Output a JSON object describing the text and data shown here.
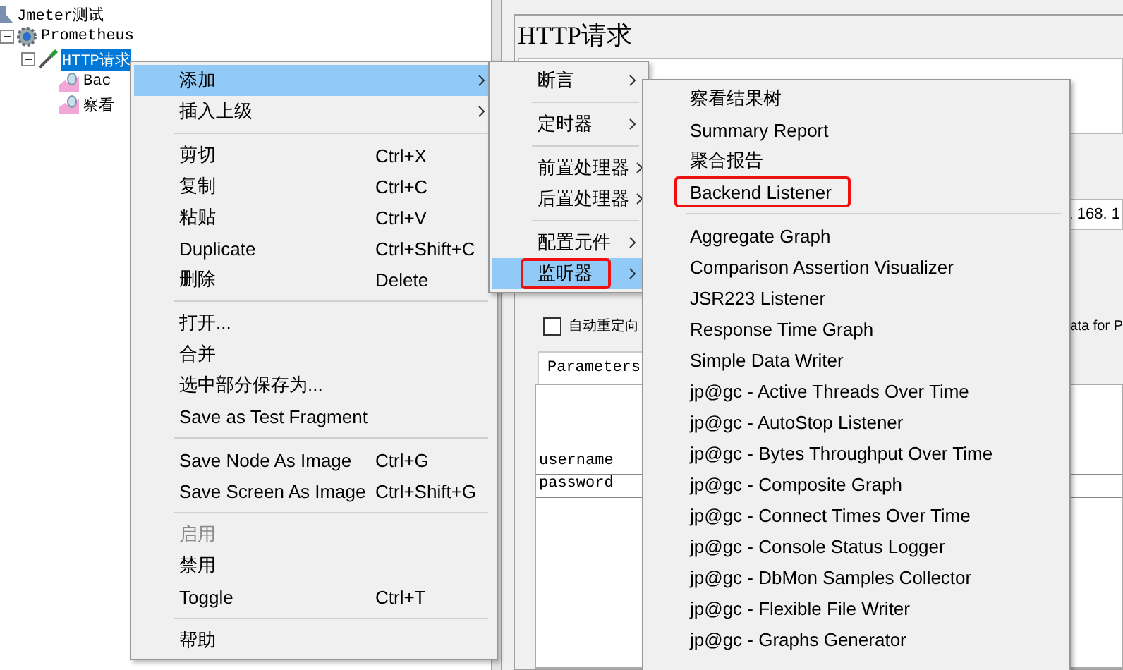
{
  "tree": [
    {
      "label": "Jmeter测试",
      "selected": false,
      "children": [
        {
          "label": "Prometheus",
          "selected": false,
          "expanded": true,
          "children": [
            {
              "label": "HTTP请求",
              "selected": true,
              "expanded": true,
              "children": [
                {
                  "label": "Bac",
                  "selected": false
                },
                {
                  "label": "察看",
                  "selected": false
                }
              ]
            }
          ]
        }
      ]
    }
  ],
  "editor": {
    "title": "HTTP请求",
    "server_fragment": ". 168. 1",
    "redirect_checkbox": {
      "label": "自动重定向",
      "checked": false
    },
    "option_fragment": "ata for P",
    "tabs": [
      {
        "label": "Parameters",
        "selected": true
      }
    ],
    "parameters": [
      {
        "name": "username"
      },
      {
        "name": "password"
      }
    ]
  },
  "context_menu": {
    "items": [
      {
        "kind": "item",
        "label": "添加",
        "submenu": true,
        "selected": true,
        "disabled": false,
        "annotated": false
      },
      {
        "kind": "item",
        "label": "插入上级",
        "submenu": true,
        "selected": false,
        "disabled": false,
        "annotated": false
      },
      {
        "kind": "separator"
      },
      {
        "kind": "item",
        "label": "剪切",
        "shortcut": "Ctrl+X",
        "submenu": false,
        "selected": false,
        "disabled": false,
        "annotated": false
      },
      {
        "kind": "item",
        "label": "复制",
        "shortcut": "Ctrl+C",
        "submenu": false,
        "selected": false,
        "disabled": false,
        "annotated": false
      },
      {
        "kind": "item",
        "label": "粘贴",
        "shortcut": "Ctrl+V",
        "submenu": false,
        "selected": false,
        "disabled": false,
        "annotated": false
      },
      {
        "kind": "item",
        "label": "Duplicate",
        "shortcut": "Ctrl+Shift+C",
        "submenu": false,
        "selected": false,
        "disabled": false,
        "annotated": false
      },
      {
        "kind": "item",
        "label": "删除",
        "shortcut": "Delete",
        "submenu": false,
        "selected": false,
        "disabled": false,
        "annotated": false
      },
      {
        "kind": "separator"
      },
      {
        "kind": "item",
        "label": "打开...",
        "submenu": false,
        "selected": false,
        "disabled": false,
        "annotated": false
      },
      {
        "kind": "item",
        "label": "合并",
        "submenu": false,
        "selected": false,
        "disabled": false,
        "annotated": false
      },
      {
        "kind": "item",
        "label": "选中部分保存为...",
        "submenu": false,
        "selected": false,
        "disabled": false,
        "annotated": false
      },
      {
        "kind": "item",
        "label": "Save as Test Fragment",
        "submenu": false,
        "selected": false,
        "disabled": false,
        "annotated": false
      },
      {
        "kind": "separator"
      },
      {
        "kind": "item",
        "label": "Save Node As Image",
        "shortcut": "Ctrl+G",
        "submenu": false,
        "selected": false,
        "disabled": false,
        "annotated": false
      },
      {
        "kind": "item",
        "label": "Save Screen As Image",
        "shortcut": "Ctrl+Shift+G",
        "submenu": false,
        "selected": false,
        "disabled": false,
        "annotated": false
      },
      {
        "kind": "separator"
      },
      {
        "kind": "item",
        "label": "启用",
        "submenu": false,
        "selected": false,
        "disabled": true,
        "annotated": false
      },
      {
        "kind": "item",
        "label": "禁用",
        "submenu": false,
        "selected": false,
        "disabled": false,
        "annotated": false
      },
      {
        "kind": "item",
        "label": "Toggle",
        "shortcut": "Ctrl+T",
        "submenu": false,
        "selected": false,
        "disabled": false,
        "annotated": false
      },
      {
        "kind": "separator"
      },
      {
        "kind": "item",
        "label": "帮助",
        "submenu": false,
        "selected": false,
        "disabled": false,
        "annotated": false
      }
    ]
  },
  "add_submenu": {
    "items": [
      {
        "kind": "item",
        "label": "断言",
        "submenu": true,
        "selected": false,
        "disabled": false,
        "annotated": false
      },
      {
        "kind": "separator"
      },
      {
        "kind": "item",
        "label": "定时器",
        "submenu": true,
        "selected": false,
        "disabled": false,
        "annotated": false
      },
      {
        "kind": "separator"
      },
      {
        "kind": "item",
        "label": "前置处理器",
        "submenu": true,
        "selected": false,
        "disabled": false,
        "annotated": false
      },
      {
        "kind": "item",
        "label": "后置处理器",
        "submenu": true,
        "selected": false,
        "disabled": false,
        "annotated": false
      },
      {
        "kind": "separator"
      },
      {
        "kind": "item",
        "label": "配置元件",
        "submenu": true,
        "selected": false,
        "disabled": false,
        "annotated": false
      },
      {
        "kind": "item",
        "label": "监听器",
        "submenu": true,
        "selected": true,
        "disabled": false,
        "annotated": true
      }
    ]
  },
  "listener_submenu": {
    "items": [
      {
        "kind": "item",
        "label": "察看结果树",
        "submenu": false,
        "selected": false,
        "disabled": false,
        "annotated": false
      },
      {
        "kind": "item",
        "label": "Summary Report",
        "submenu": false,
        "selected": false,
        "disabled": false,
        "annotated": false
      },
      {
        "kind": "item",
        "label": "聚合报告",
        "submenu": false,
        "selected": false,
        "disabled": false,
        "annotated": false
      },
      {
        "kind": "item",
        "label": "Backend Listener",
        "submenu": false,
        "selected": false,
        "disabled": false,
        "annotated": true
      },
      {
        "kind": "separator"
      },
      {
        "kind": "item",
        "label": "Aggregate Graph",
        "submenu": false,
        "selected": false,
        "disabled": false,
        "annotated": false
      },
      {
        "kind": "item",
        "label": "Comparison Assertion Visualizer",
        "submenu": false,
        "selected": false,
        "disabled": false,
        "annotated": false
      },
      {
        "kind": "item",
        "label": "JSR223 Listener",
        "submenu": false,
        "selected": false,
        "disabled": false,
        "annotated": false
      },
      {
        "kind": "item",
        "label": "Response Time Graph",
        "submenu": false,
        "selected": false,
        "disabled": false,
        "annotated": false
      },
      {
        "kind": "item",
        "label": "Simple Data Writer",
        "submenu": false,
        "selected": false,
        "disabled": false,
        "annotated": false
      },
      {
        "kind": "item",
        "label": "jp@gc - Active Threads Over Time",
        "submenu": false,
        "selected": false,
        "disabled": false,
        "annotated": false
      },
      {
        "kind": "item",
        "label": "jp@gc - AutoStop Listener",
        "submenu": false,
        "selected": false,
        "disabled": false,
        "annotated": false
      },
      {
        "kind": "item",
        "label": "jp@gc - Bytes Throughput Over Time",
        "submenu": false,
        "selected": false,
        "disabled": false,
        "annotated": false
      },
      {
        "kind": "item",
        "label": "jp@gc - Composite Graph",
        "submenu": false,
        "selected": false,
        "disabled": false,
        "annotated": false
      },
      {
        "kind": "item",
        "label": "jp@gc - Connect Times Over Time",
        "submenu": false,
        "selected": false,
        "disabled": false,
        "annotated": false
      },
      {
        "kind": "item",
        "label": "jp@gc - Console Status Logger",
        "submenu": false,
        "selected": false,
        "disabled": false,
        "annotated": false
      },
      {
        "kind": "item",
        "label": "jp@gc - DbMon Samples Collector",
        "submenu": false,
        "selected": false,
        "disabled": false,
        "annotated": false
      },
      {
        "kind": "item",
        "label": "jp@gc - Flexible File Writer",
        "submenu": false,
        "selected": false,
        "disabled": false,
        "annotated": false
      },
      {
        "kind": "item",
        "label": "jp@gc - Graphs Generator",
        "submenu": false,
        "selected": false,
        "disabled": false,
        "annotated": false
      }
    ]
  }
}
